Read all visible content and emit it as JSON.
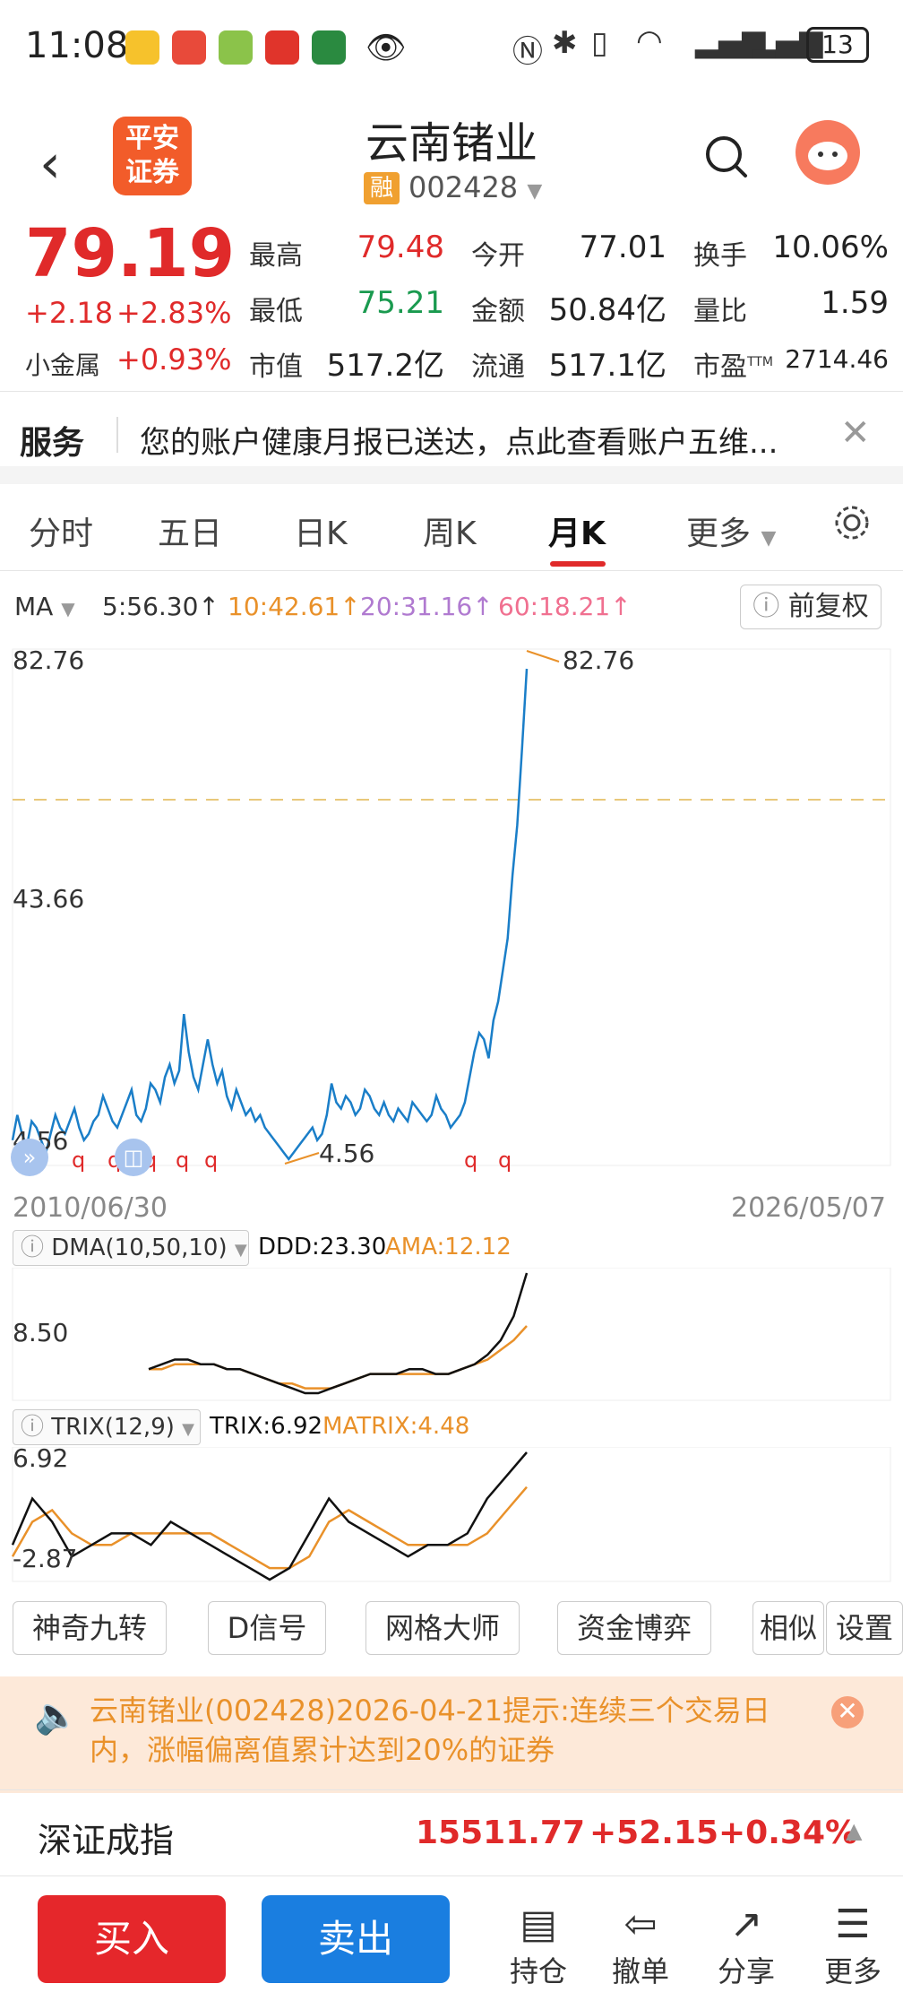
{
  "status": {
    "time": "11:08",
    "battery": "13"
  },
  "header": {
    "logo_line1": "平安",
    "logo_line2": "证券",
    "title": "云南锗业",
    "rong": "融",
    "code": "002428"
  },
  "quote": {
    "price": "79.19",
    "change": "+2.18",
    "change_pct": "+2.83%",
    "sector_name": "小金属",
    "sector_pct": "+0.93%",
    "high_label": "最高",
    "high": "79.48",
    "low_label": "最低",
    "low": "75.21",
    "mktcap_label": "市值",
    "mktcap": "517.2亿",
    "open_label": "今开",
    "open": "77.01",
    "amount_label": "金额",
    "amount": "50.84亿",
    "float_label": "流通",
    "float": "517.1亿",
    "turnover_label": "换手",
    "turnover": "10.06%",
    "vol_ratio_label": "量比",
    "vol_ratio": "1.59",
    "pe_label": "市盈",
    "pe_sup": "TTM",
    "pe": "2714.46"
  },
  "service": {
    "title": "服务",
    "text": "您的账户健康月报已送达，点此查看账户五维..."
  },
  "tabs": [
    {
      "label": "分时"
    },
    {
      "label": "五日"
    },
    {
      "label": "日K"
    },
    {
      "label": "周K"
    },
    {
      "label": "月K"
    },
    {
      "label": "更多"
    }
  ],
  "ma": {
    "label": "MA",
    "ma5": "5:56.30↑",
    "ma10": "10:42.61↑",
    "ma20": "20:31.16↑",
    "ma60": "60:18.21↑",
    "adjust": "前复权"
  },
  "chart_data": [
    {
      "type": "line",
      "name_label": "月K",
      "y_top_label": "82.76",
      "y_mid_label": "43.66",
      "y_low_label": "4.56",
      "max_annotation": "82.76",
      "min_annotation": "4.56",
      "x_start": "2010/06/30",
      "x_end": "2026/05/07",
      "ylim": [
        4.56,
        82.76
      ],
      "reference_line": 62.0,
      "markers": [
        "q",
        "q",
        "q",
        "q",
        "q",
        "q",
        "q",
        "q"
      ],
      "series": [
        {
          "values": [
            8,
            12,
            9,
            7,
            11,
            10,
            8,
            6,
            9,
            12,
            10,
            9,
            11,
            13,
            10,
            8,
            9,
            11,
            12,
            15,
            13,
            11,
            10,
            12,
            14,
            16,
            12,
            11,
            13,
            17,
            16,
            14,
            18,
            20,
            17,
            19,
            28,
            22,
            18,
            16,
            20,
            24,
            20,
            17,
            19,
            15,
            13,
            16,
            14,
            12,
            13,
            11,
            12,
            10,
            9,
            8,
            7,
            6,
            5,
            6,
            7,
            8,
            9,
            10,
            8,
            9,
            12,
            17,
            14,
            13,
            15,
            14,
            12,
            13,
            16,
            15,
            13,
            12,
            14,
            12,
            11,
            13,
            12,
            11,
            14,
            13,
            12,
            11,
            12,
            15,
            13,
            12,
            10,
            11,
            12,
            14,
            18,
            22,
            25,
            24,
            21,
            27,
            30,
            35,
            40,
            50,
            58,
            70,
            82.76
          ]
        }
      ]
    },
    {
      "type": "line",
      "indicator": "DMA(10,50,10)",
      "ddd_label": "DDD:23.30",
      "ama_label": "AMA:12.12",
      "y_label": "8.50",
      "series": [
        {
          "name": "DDD",
          "values": [
            4,
            5,
            6,
            6,
            5,
            5,
            4,
            4,
            3,
            2,
            1,
            0,
            -1,
            -1,
            0,
            1,
            2,
            3,
            3,
            3,
            4,
            4,
            3,
            3,
            4,
            5,
            7,
            10,
            15,
            24
          ]
        },
        {
          "name": "AMA",
          "values": [
            4,
            4,
            5,
            5,
            5,
            5,
            4,
            4,
            3,
            2,
            1,
            1,
            0,
            0,
            0,
            1,
            2,
            3,
            3,
            3,
            3,
            3,
            3,
            3,
            4,
            5,
            6,
            8,
            10,
            13
          ]
        }
      ]
    },
    {
      "type": "line",
      "indicator": "TRIX(12,9)",
      "trix_label": "TRIX:6.92",
      "matrix_label": "MATRIX:4.48",
      "y_top_label": "6.92",
      "y_low_label": "-2.87",
      "series": [
        {
          "name": "TRIX",
          "values": [
            -1,
            3,
            1,
            -2,
            -1,
            0,
            0,
            -1,
            1,
            0,
            -1,
            -2,
            -3,
            -4,
            -3,
            0,
            3,
            1,
            0,
            -1,
            -2,
            -1,
            -1,
            0,
            3,
            5,
            7
          ]
        },
        {
          "name": "MATRIX",
          "values": [
            -2,
            1,
            2,
            0,
            -1,
            -1,
            0,
            0,
            0,
            0,
            0,
            -1,
            -2,
            -3,
            -3,
            -2,
            1,
            2,
            1,
            0,
            -1,
            -1,
            -1,
            -1,
            0,
            2,
            4
          ]
        }
      ]
    }
  ],
  "tools": [
    {
      "label": "神奇九转"
    },
    {
      "label": "D信号"
    },
    {
      "label": "网格大师"
    },
    {
      "label": "资金博弈"
    },
    {
      "label": "相似"
    },
    {
      "label": "设置"
    }
  ],
  "notice": {
    "text": "云南锗业(002428)2026-04-21提示:连续三个交易日内，涨幅偏离值累计达到20%的证券"
  },
  "index": {
    "name": "深证成指",
    "value": "15511.77",
    "change": "+52.15",
    "pct": "+0.34%"
  },
  "bottom": {
    "buy": "买入",
    "sell": "卖出",
    "nav": [
      {
        "label": "持仓"
      },
      {
        "label": "撤单"
      },
      {
        "label": "分享"
      },
      {
        "label": "更多"
      }
    ]
  },
  "colors": {
    "up": "#e02a2a",
    "down": "#1a9a4f",
    "line": "#1a7ec8",
    "ma10": "#e9912a",
    "ma20": "#b07ad0",
    "ma60": "#f07090"
  }
}
